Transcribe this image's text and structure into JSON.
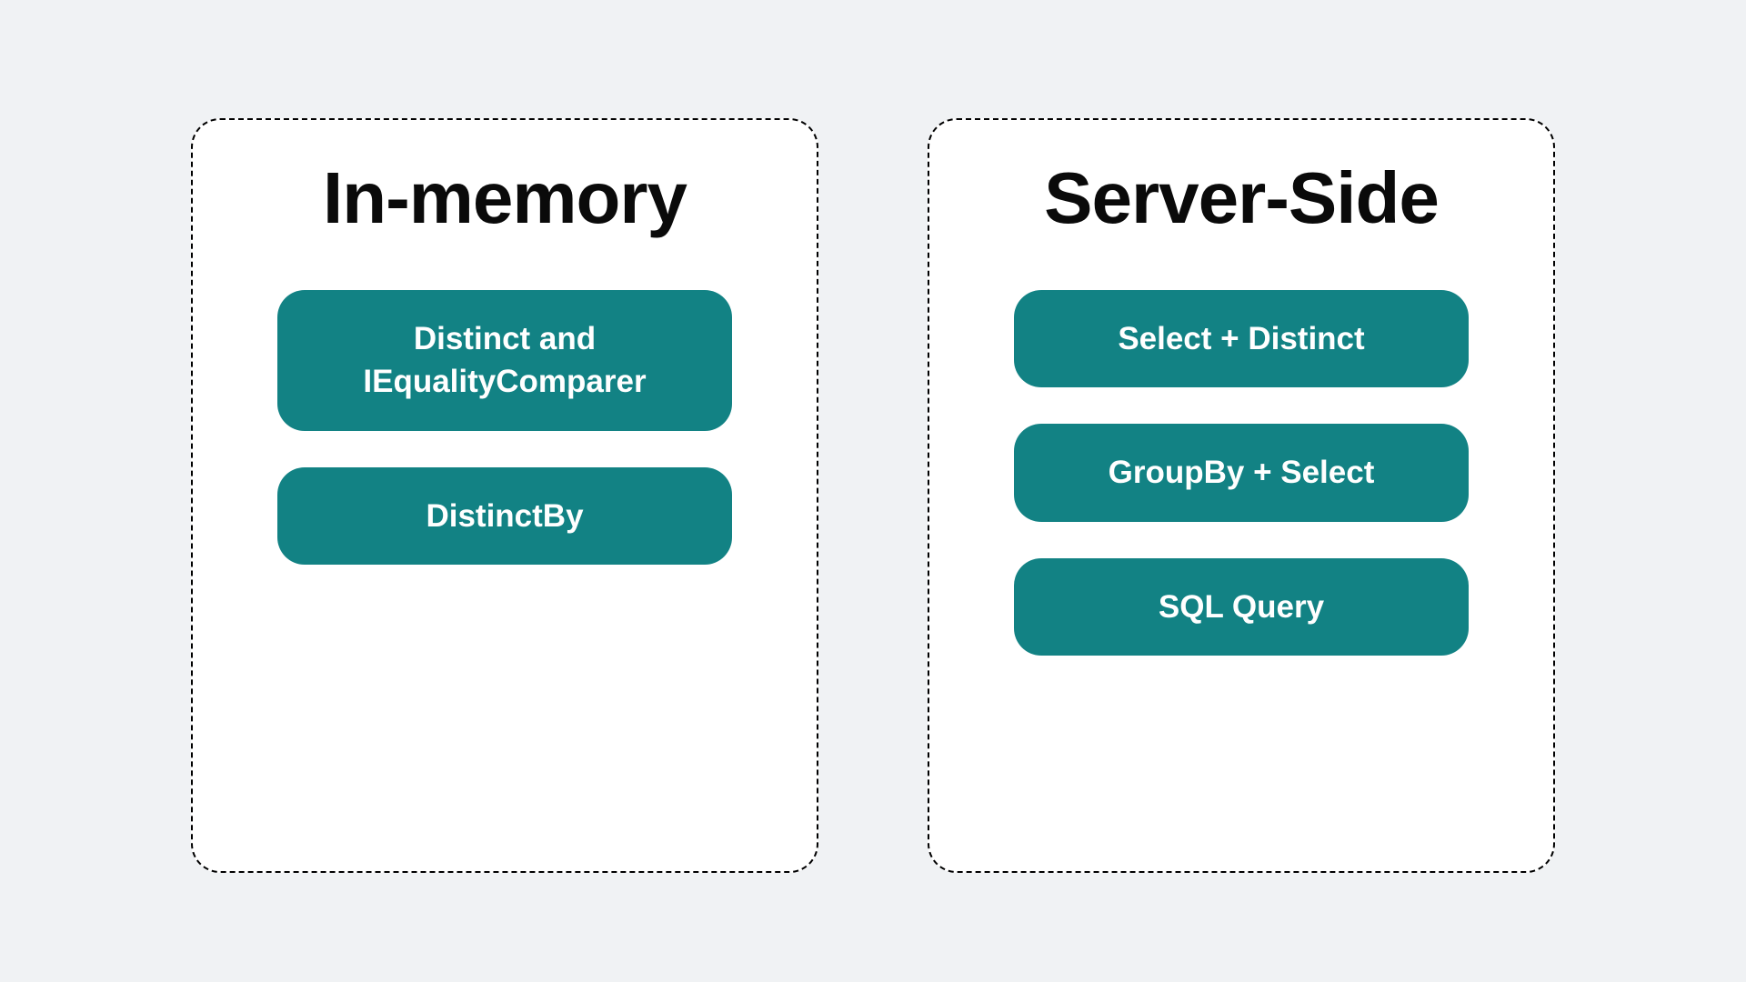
{
  "panels": [
    {
      "title": "In-memory",
      "items": [
        "Distinct and IEqualityComparer",
        "DistinctBy"
      ]
    },
    {
      "title": "Server-Side",
      "items": [
        "Select + Distinct",
        "GroupBy + Select",
        "SQL Query"
      ]
    }
  ],
  "colors": {
    "background": "#f0f2f4",
    "panelBackground": "#ffffff",
    "pillBackground": "#128284",
    "text": "#0a0a0a",
    "pillText": "#ffffff"
  }
}
